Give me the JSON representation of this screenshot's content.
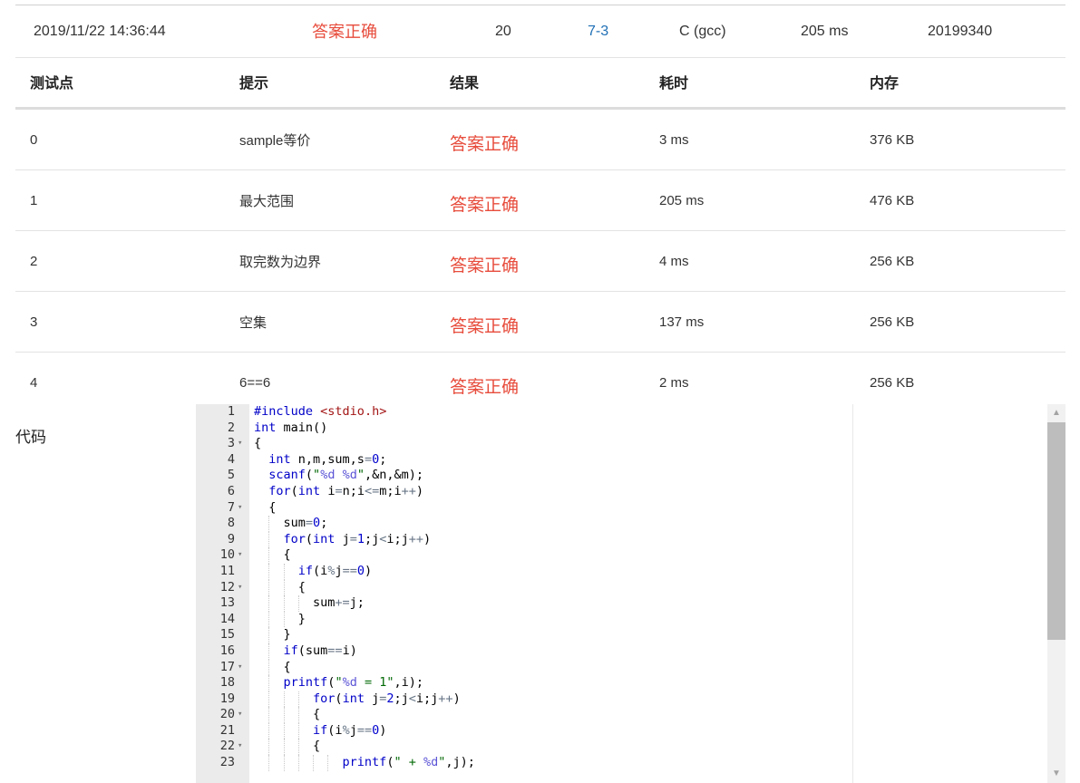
{
  "submission": {
    "time": "2019/11/22 14:36:44",
    "status": "答案正确",
    "score": "20",
    "problem": "7-3",
    "compiler": "C (gcc)",
    "duration": "205 ms",
    "user": "20199340"
  },
  "test_table": {
    "headers": [
      "测试点",
      "提示",
      "结果",
      "耗时",
      "内存"
    ],
    "rows": [
      {
        "id": "0",
        "hint": "sample等价",
        "result": "答案正确",
        "time": "3 ms",
        "memory": "376 KB"
      },
      {
        "id": "1",
        "hint": "最大范围",
        "result": "答案正确",
        "time": "205 ms",
        "memory": "476 KB"
      },
      {
        "id": "2",
        "hint": "取完数为边界",
        "result": "答案正确",
        "time": "4 ms",
        "memory": "256 KB"
      },
      {
        "id": "3",
        "hint": "空集",
        "result": "答案正确",
        "time": "137 ms",
        "memory": "256 KB"
      },
      {
        "id": "4",
        "hint": "6==6",
        "result": "答案正确",
        "time": "2 ms",
        "memory": "256 KB"
      }
    ]
  },
  "code_section": {
    "label": "代码",
    "lines": [
      "#include <stdio.h>",
      "int main()",
      "{",
      "  int n,m,sum,s=0;",
      "  scanf(\"%d %d\",&n,&m);",
      "  for(int i=n;i<=m;i++)",
      "  {",
      "    sum=0;",
      "    for(int j=1;j<i;j++)",
      "    {",
      "      if(i%j==0)",
      "      {",
      "        sum+=j;",
      "      }",
      "    }",
      "    if(sum==i)",
      "    {",
      "    printf(\"%d = 1\",i);",
      "        for(int j=2;j<i;j++)",
      "        {",
      "        if(i%j==0)",
      "        {",
      "            printf(\" + %d\",j);"
    ],
    "fold_lines": [
      3,
      7,
      10,
      12,
      17,
      20,
      22
    ]
  },
  "scrollbar": {
    "up_icon": "chevron-up-icon",
    "down_icon": "chevron-down-icon"
  },
  "colors": {
    "success": "#e74c3c",
    "link": "#1f6fb5",
    "gutter": "#ebebeb"
  }
}
